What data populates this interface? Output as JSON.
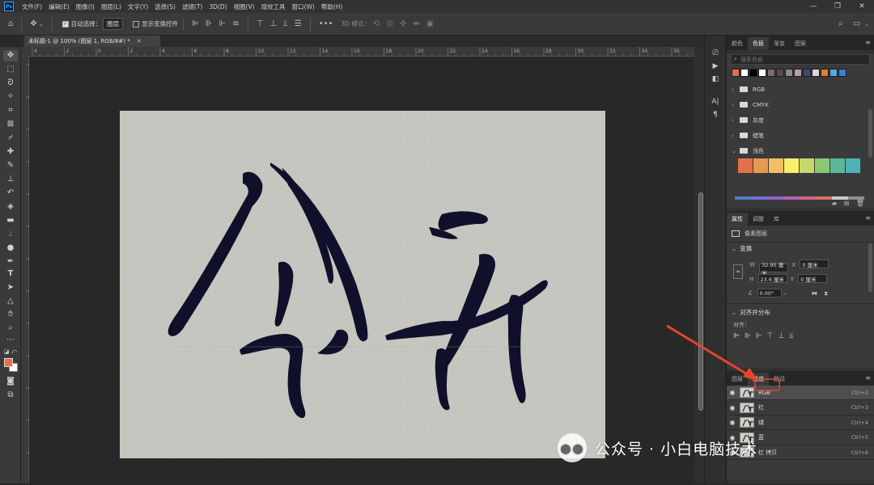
{
  "app": {
    "logo_text": "Ps"
  },
  "menu": [
    "文件(F)",
    "编辑(E)",
    "图像(I)",
    "图层(L)",
    "文字(Y)",
    "选择(S)",
    "滤镜(T)",
    "3D(D)",
    "视图(V)",
    "增效工具",
    "窗口(W)",
    "帮助(H)"
  ],
  "options": {
    "auto_select_label": "自动选择：",
    "auto_select_value": "图层",
    "show_transform_label": "显示变换控件",
    "mode_3d_label": "3D 模式："
  },
  "document": {
    "tab_title": "未标题-1 @ 100% (图层 1, RGB/8#) *"
  },
  "rulers": {
    "h_ticks": [
      "4",
      "2",
      "0",
      "2",
      "4",
      "6",
      "8",
      "10",
      "12",
      "14",
      "16",
      "18",
      "20",
      "22",
      "24",
      "26",
      "28",
      "30",
      "32",
      "34",
      "36"
    ]
  },
  "swatches": {
    "tabs": [
      "颜色",
      "色板",
      "渐变",
      "图案"
    ],
    "active_tab": "色板",
    "search_placeholder": "搜索色板",
    "recent_colors": [
      "#e2704f",
      "#ffffff",
      "#000000",
      "#ffffff",
      "#7f6e6e",
      "#5a4a46",
      "#8a8a94",
      "#b79fa3",
      "#3a4c7a",
      "#d8d8d8",
      "#e87b3a",
      "#5aa9d8",
      "#3c7ed6"
    ],
    "groups": [
      {
        "name": "RGB",
        "open": false
      },
      {
        "name": "CMYK",
        "open": false
      },
      {
        "name": "灰度",
        "open": false
      },
      {
        "name": "蜡笔",
        "open": false
      },
      {
        "name": "浅色",
        "open": true
      }
    ],
    "light_colors": [
      "#e0714a",
      "#ea9a4f",
      "#f0bf5f",
      "#f8ef6b",
      "#c4d96a",
      "#8cc774",
      "#5ab79a",
      "#4fb3b6"
    ]
  },
  "properties": {
    "tabs": [
      "属性",
      "调整",
      "库"
    ],
    "active_tab": "属性",
    "layer_type": "像素图层",
    "transform_heading": "变换",
    "w_label": "W",
    "w_value": "32.95 厘米",
    "x_label": "X",
    "x_value": "0 厘米",
    "h_label": "H",
    "h_value": "23.6 厘米",
    "y_label": "Y",
    "y_value": "0 厘米",
    "angle_value": "0.00°",
    "align_heading": "对齐并分布",
    "align_label": "对齐："
  },
  "channels": {
    "tabs": [
      "图层",
      "通道",
      "路径"
    ],
    "active_tab": "通道",
    "rows": [
      {
        "name": "RGB",
        "shortcut": "Ctrl+2",
        "selected": true
      },
      {
        "name": "红",
        "shortcut": "Ctrl+3",
        "selected": false
      },
      {
        "name": "绿",
        "shortcut": "Ctrl+4",
        "selected": false
      },
      {
        "name": "蓝",
        "shortcut": "Ctrl+5",
        "selected": false
      },
      {
        "name": "红 拷贝",
        "shortcut": "Ctrl+6",
        "selected": false
      }
    ]
  },
  "watermark": {
    "text": "公众号 · 小白电脑技术"
  },
  "colors": {
    "accent": "#31a8ff",
    "highlight": "#e8432f",
    "foreground": "#e2704f",
    "ink": "#10102a"
  }
}
